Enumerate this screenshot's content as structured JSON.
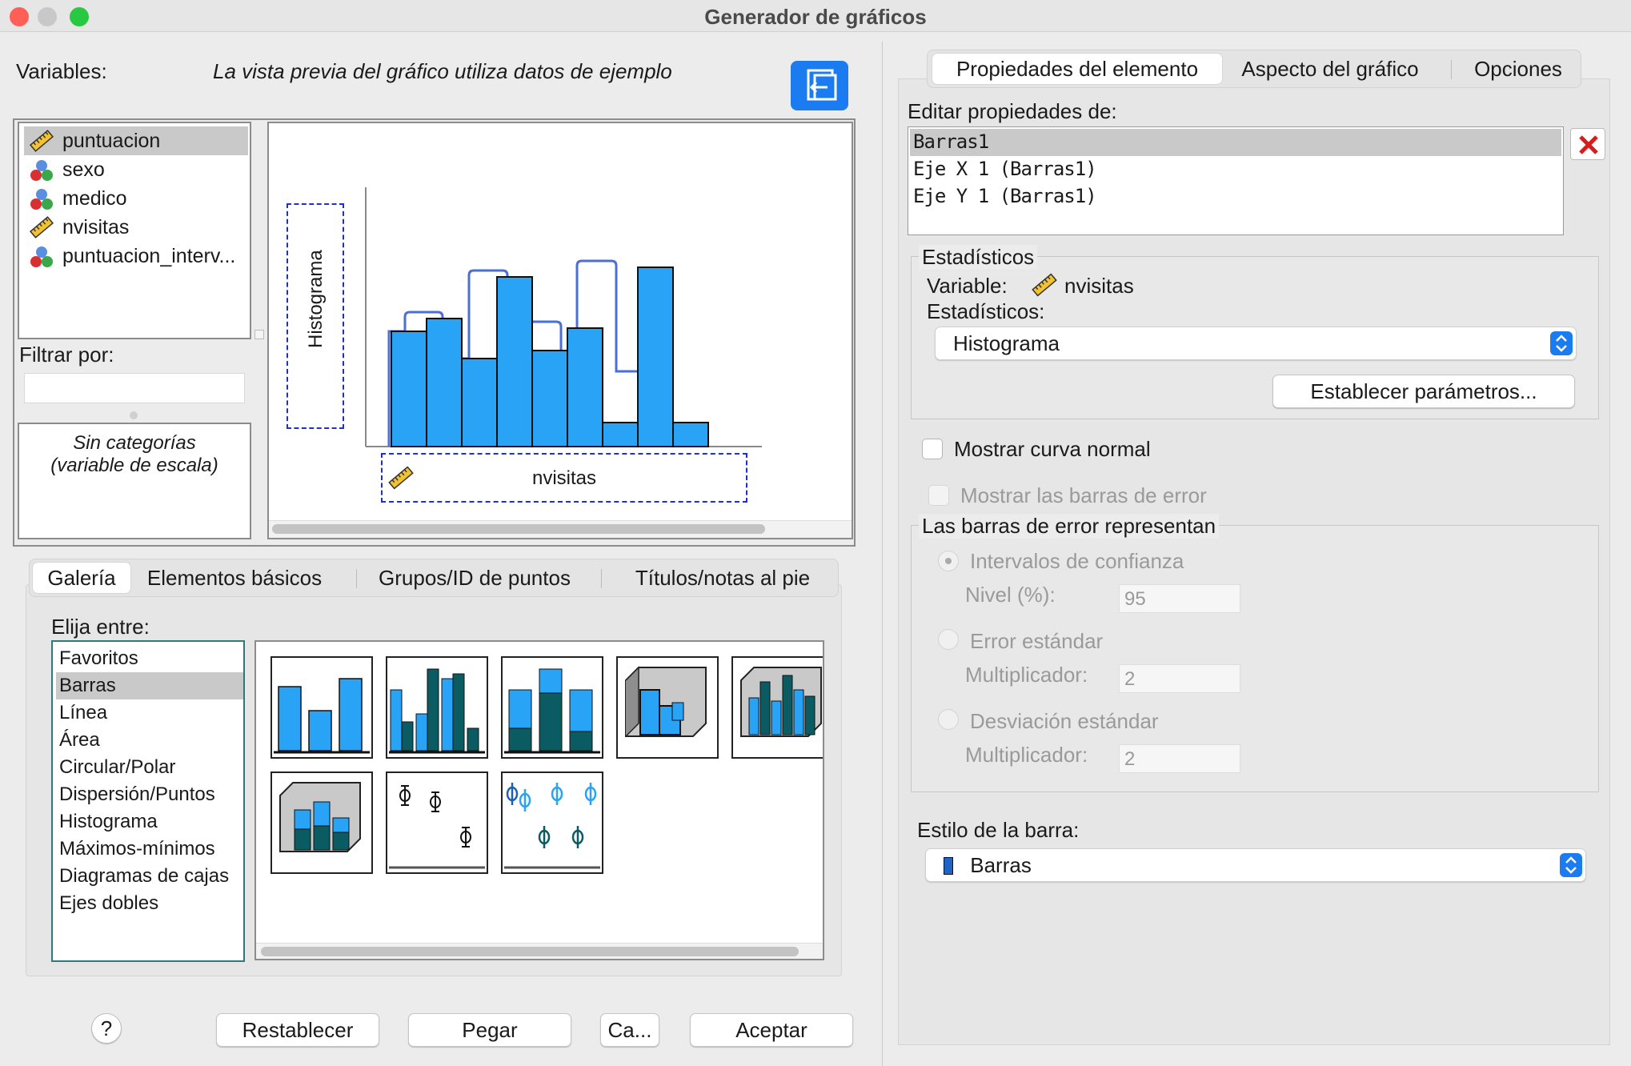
{
  "window": {
    "title": "Generador de gráficos"
  },
  "left": {
    "variables_label": "Variables:",
    "preview_note": "La vista previa del gráfico utiliza datos de ejemplo",
    "variables": [
      {
        "name": "puntuacion",
        "icon": "ruler-scale-icon",
        "selected": true
      },
      {
        "name": "sexo",
        "icon": "nominal-balls-icon"
      },
      {
        "name": "medico",
        "icon": "nominal-balls-icon"
      },
      {
        "name": "nvisitas",
        "icon": "ruler-scale-icon"
      },
      {
        "name": "puntuacion_interv...",
        "icon": "nominal-balls-icon"
      }
    ],
    "filter_label": "Filtrar por:",
    "no_categories_line1": "Sin categorías",
    "no_categories_line2": "(variable de escala)",
    "preview": {
      "y_drop_label": "Histograma",
      "x_drop_label": "nvisitas"
    },
    "tabs": [
      "Galería",
      "Elementos básicos",
      "Grupos/ID de puntos",
      "Títulos/notas al pie"
    ],
    "choose_label": "Elija entre:",
    "gallery_types": [
      "Favoritos",
      "Barras",
      "Línea",
      "Área",
      "Circular/Polar",
      "Dispersión/Puntos",
      "Histograma",
      "Máximos-mínimos",
      "Diagramas de cajas",
      "Ejes dobles"
    ],
    "gallery_selected": "Barras"
  },
  "buttons": {
    "help": "?",
    "reset": "Restablecer",
    "paste": "Pegar",
    "cancel": "Ca...",
    "ok": "Aceptar"
  },
  "right": {
    "tabs": [
      "Propiedades del elemento",
      "Aspecto del gráfico",
      "Opciones"
    ],
    "edit_label": "Editar propiedades de:",
    "elements": [
      "Barras1",
      "Eje X 1 (Barras1)",
      "Eje Y 1 (Barras1)"
    ],
    "stats_group": "Estadísticos",
    "variable_label": "Variable:",
    "variable_value": "nvisitas",
    "stats_label": "Estadísticos:",
    "stats_value": "Histograma",
    "set_params": "Establecer parámetros...",
    "normal_curve": "Mostrar curva normal",
    "error_bars": "Mostrar las barras de error",
    "error_group": "Las barras de error representan",
    "ci": "Intervalos de confianza",
    "level_label": "Nivel (%):",
    "level_value": "95",
    "se": "Error estándar",
    "mult_label": "Multiplicador:",
    "se_mult": "2",
    "sd": "Desviación estándar",
    "sd_mult": "2",
    "bar_style_label": "Estilo de la barra:",
    "bar_style_value": "Barras"
  },
  "colors": {
    "accent": "#1a7cf0",
    "bar": "#29a3f5",
    "teal": "#0b5b63"
  }
}
